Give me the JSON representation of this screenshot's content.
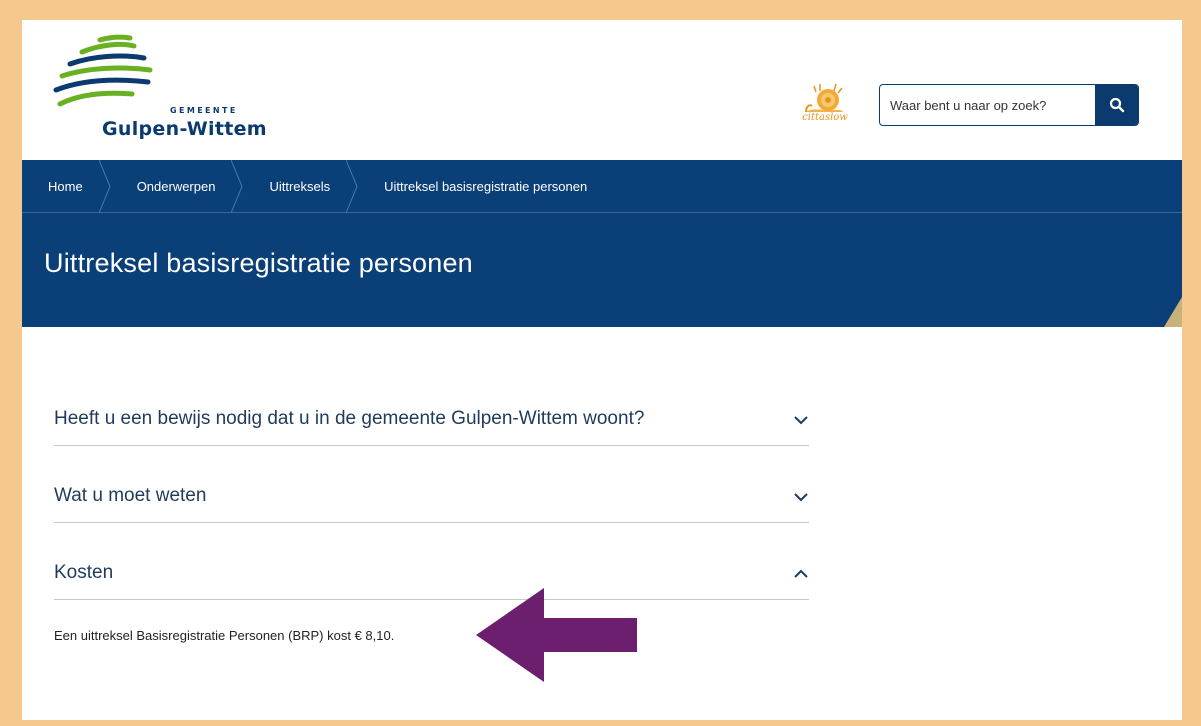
{
  "header": {
    "logo": {
      "small_text": "GEMEENTE",
      "name": "Gulpen-Wittem"
    },
    "partner_logo": {
      "text": "cittaslow"
    },
    "search": {
      "placeholder": "Waar bent u naar op zoek?",
      "icon": "search-icon"
    }
  },
  "breadcrumb": {
    "items": [
      "Home",
      "Onderwerpen",
      "Uittreksels",
      "Uittreksel basisregistratie personen"
    ]
  },
  "page": {
    "title": "Uittreksel basisregistratie personen"
  },
  "accordion": {
    "items": [
      {
        "title": "Heeft u een bewijs nodig dat u in de gemeente Gulpen-Wittem woont?",
        "state": "collapsed"
      },
      {
        "title": "Wat u moet weten",
        "state": "collapsed"
      },
      {
        "title": "Kosten",
        "state": "expanded",
        "body": "Een uittreksel Basisregistratie Personen (BRP) kost € 8,10."
      }
    ]
  },
  "colors": {
    "frame": "#f5c88e",
    "brand_blue": "#0b3f78",
    "arrow": "#6b1f6e",
    "logo_green": "#6ab023"
  }
}
